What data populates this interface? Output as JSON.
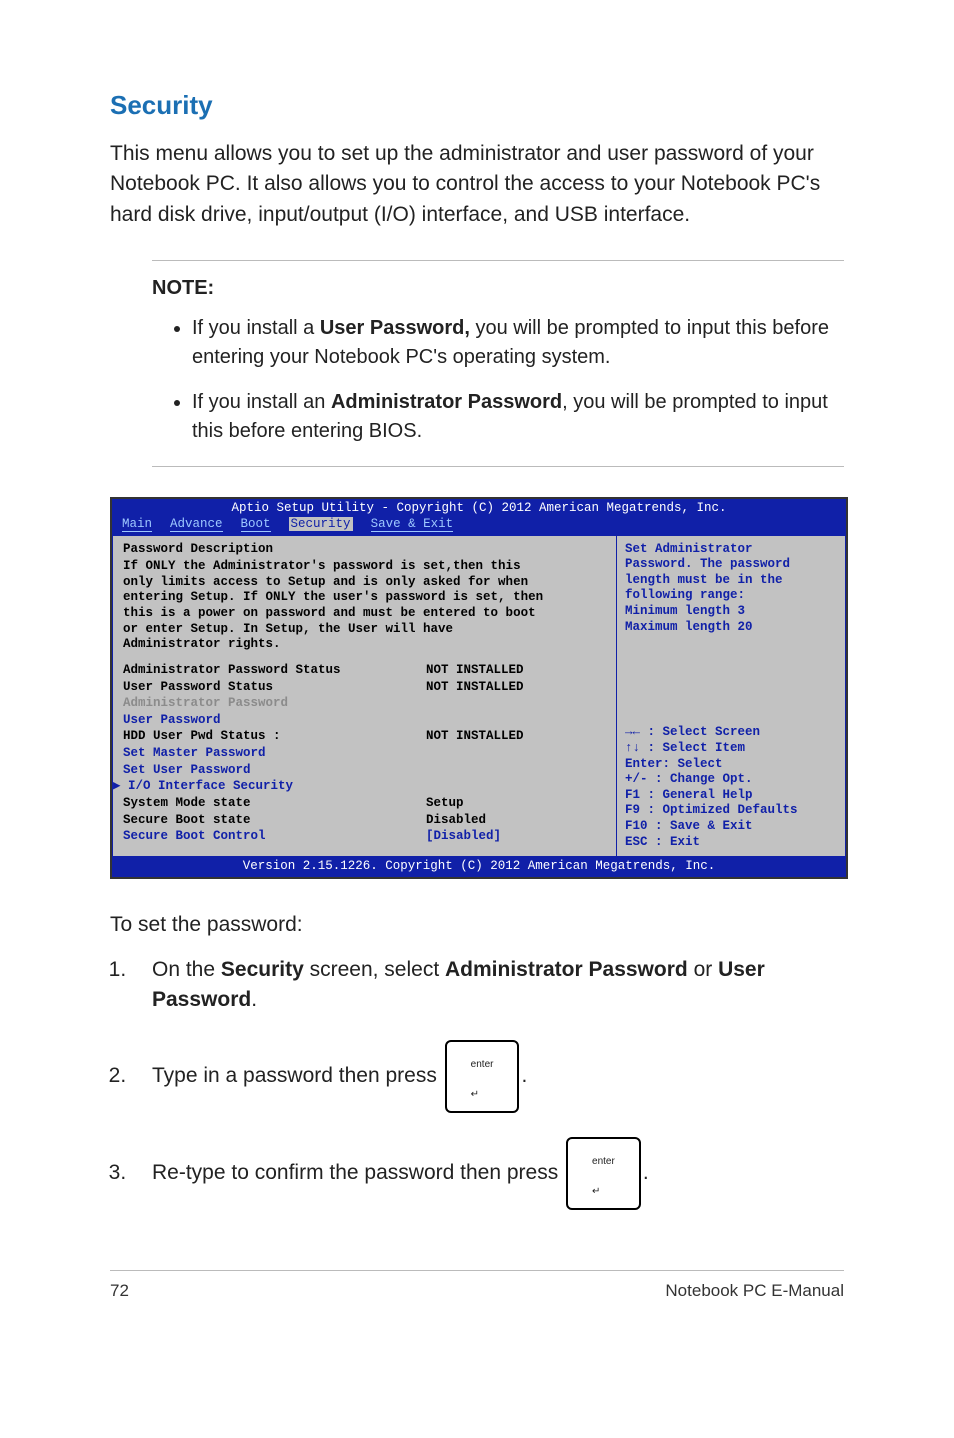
{
  "heading": "Security",
  "intro": "This menu allows you to set up the administrator and user password of your Notebook PC. It also allows you to control the access to your Notebook PC's hard disk drive, input/output (I/O) interface, and USB interface.",
  "note_label": "NOTE:",
  "note_items": {
    "a_pre": "If you install a ",
    "a_bold": "User Password,",
    "a_post": " you will be prompted to input this before entering your Notebook PC's operating system.",
    "b_pre": "If you install an ",
    "b_bold": "Administrator Password",
    "b_post": ", you will be prompted to input this before entering BIOS."
  },
  "bios": {
    "title": "Aptio Setup Utility - Copyright (C) 2012 American Megatrends, Inc.",
    "menu": [
      "Main",
      "Advance",
      "Boot",
      "Security",
      "Save & Exit"
    ],
    "active_index": 3,
    "desc_title": "Password Description",
    "desc_body": "If ONLY the Administrator's password is set,then this only limits access to Setup and is only asked for when entering Setup. If ONLY the user's password is set, then this is a power on password and must be entered to boot or enter Setup. In Setup, the User will have Administrator rights.",
    "rows": [
      {
        "label": "Administrator Password Status",
        "value": "NOT INSTALLED",
        "cls": ""
      },
      {
        "label": "User Password Status",
        "value": "NOT INSTALLED",
        "cls": ""
      },
      {
        "label": "Administrator Password",
        "value": "",
        "cls": "bios-gray"
      },
      {
        "label": "User Password",
        "value": "",
        "cls": "bios-blue"
      },
      {
        "label": "HDD User Pwd Status :",
        "value": "NOT INSTALLED",
        "cls": ""
      },
      {
        "label": "Set Master Password",
        "value": "",
        "cls": "bios-blue"
      },
      {
        "label": "Set User Password",
        "value": "",
        "cls": "bios-blue"
      },
      {
        "label": "▶ I/O Interface Security",
        "value": "",
        "cls": "bios-blue",
        "outdent": true
      },
      {
        "label": "System Mode state",
        "value": "Setup",
        "cls": ""
      },
      {
        "label": "Secure Boot state",
        "value": "Disabled",
        "cls": ""
      },
      {
        "label": "Secure Boot Control",
        "value": "[Disabled]",
        "cls": "bios-blue",
        "valcls": "bios-blue"
      }
    ],
    "help_top": [
      "Set Administrator",
      "Password. The password",
      "length must be in the",
      "following range:",
      "Minimum length 3",
      "Maximum length 20"
    ],
    "help_keys": [
      "→←  : Select Screen",
      "↑↓   : Select Item",
      "Enter: Select",
      "+/-  : Change Opt.",
      "F1   : General Help",
      "F9   : Optimized Defaults",
      "F10  : Save & Exit",
      "ESC  : Exit"
    ],
    "footer": "Version 2.15.1226. Copyright (C) 2012 American Megatrends, Inc."
  },
  "set_pwd_label": "To set the password:",
  "steps": {
    "s1_pre": "On the ",
    "s1_b1": "Security",
    "s1_mid": " screen, select ",
    "s1_b2": "Administrator Password",
    "s1_or": " or ",
    "s1_b3": "User Password",
    "s1_end": ".",
    "s2_pre": "Type in a password then press ",
    "s2_end": ".",
    "s3_pre": "Re-type to confirm the password then press ",
    "s3_end": "."
  },
  "keycap": {
    "label": "enter",
    "arrow": "↵"
  },
  "footer": {
    "page": "72",
    "title": "Notebook PC E-Manual"
  }
}
